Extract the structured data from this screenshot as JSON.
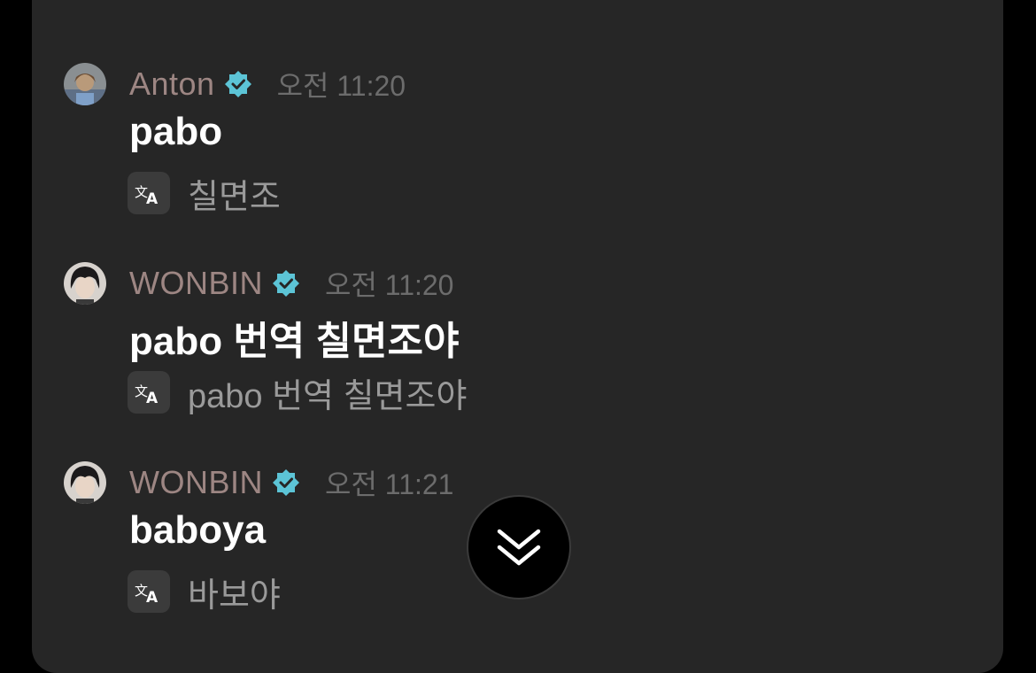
{
  "colors": {
    "background": "#000000",
    "panel": "#262626",
    "username": "#9d8683",
    "timestamp": "#6c6c6c",
    "message": "#ffffff",
    "translation": "#9a9a9a",
    "verified_badge": "#5cc4d6"
  },
  "messages": [
    {
      "author": "Anton",
      "time": "오전 11:20",
      "text": "pabo",
      "translation": "칠면조",
      "avatar_icon": "avatar-anton",
      "badge_icon": "verified-badge-icon",
      "translate_icon": "translate-icon"
    },
    {
      "author": "WONBIN",
      "time": "오전 11:20",
      "text": "pabo 번역 칠면조야",
      "translation": "pabo 번역 칠면조야",
      "avatar_icon": "avatar-wonbin",
      "badge_icon": "verified-badge-icon",
      "translate_icon": "translate-icon"
    },
    {
      "author": "WONBIN",
      "time": "오전 11:21",
      "text": "baboya",
      "translation": "바보야",
      "avatar_icon": "avatar-wonbin",
      "badge_icon": "verified-badge-icon",
      "translate_icon": "translate-icon"
    }
  ],
  "scroll_button": {
    "icon": "double-chevron-down-icon"
  }
}
